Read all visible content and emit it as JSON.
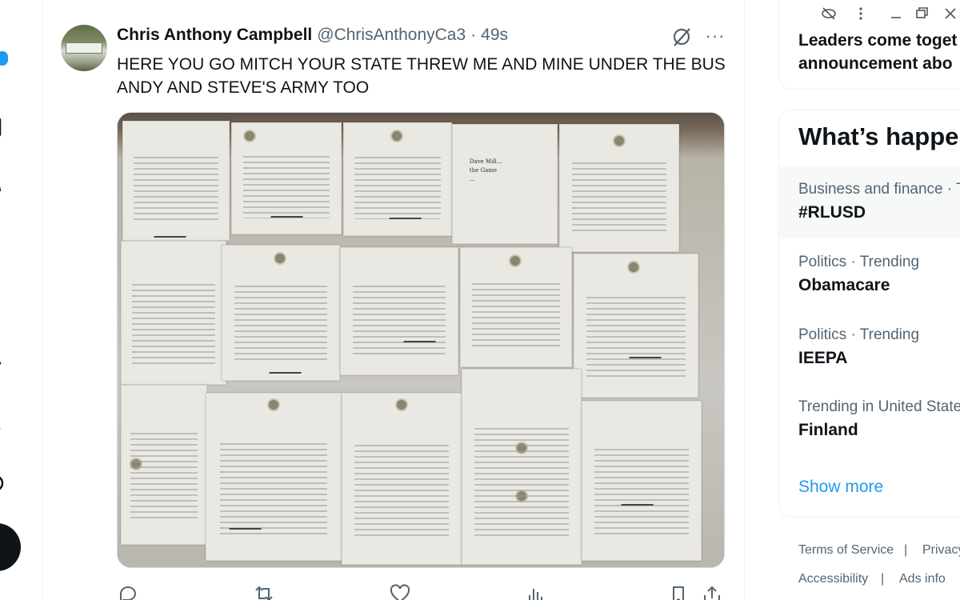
{
  "tweet": {
    "author_name": "Chris Anthony Campbell",
    "handle": "@ChrisAnthonyCa3",
    "separator": "·",
    "time": "49s",
    "text": "HERE YOU GO MITCH YOUR STATE THREW ME AND MINE UNDER THE BUS ANDY AND STEVE'S ARMY TOO",
    "more_icon": "···",
    "image_handwriting": [
      "Dave Mill...",
      "the Game",
      "..."
    ]
  },
  "sidebar": {
    "top_card_text": [
      "Leaders come toget",
      "announcement abo"
    ],
    "whats_happening_title": "What’s happen",
    "trends": [
      {
        "context": "Business and finance · T",
        "title": "#RLUSD"
      },
      {
        "context": "Politics · Trending",
        "title": "Obamacare"
      },
      {
        "context": "Politics · Trending",
        "title": "IEEPA"
      },
      {
        "context": "Trending in United State",
        "title": "Finland"
      }
    ],
    "show_more": "Show more"
  },
  "footer": {
    "links": [
      "Terms of Service",
      "Privacy",
      "Accessibility",
      "Ads info"
    ],
    "separator": "|"
  },
  "colors": {
    "accent": "#1d9bf0",
    "text_primary": "#0f1419",
    "text_secondary": "#536471"
  },
  "icons": [
    "reply-icon",
    "retweet-icon",
    "like-icon",
    "views-icon",
    "bookmark-icon",
    "share-icon",
    "grok-icon",
    "more-icon"
  ]
}
